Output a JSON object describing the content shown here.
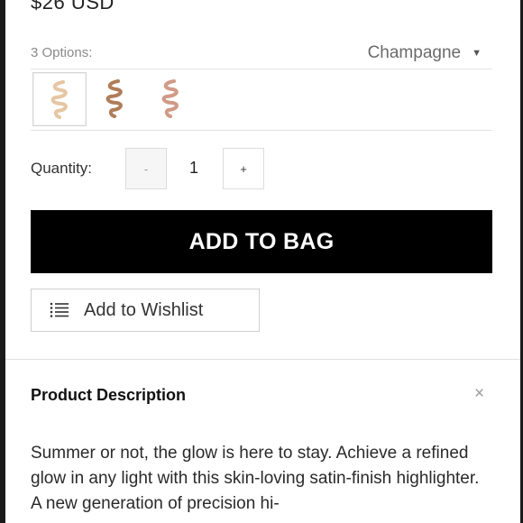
{
  "product": {
    "price": "$26 USD"
  },
  "options": {
    "label": "3 Options:",
    "selected_shade": "Champagne",
    "swatches": [
      {
        "name": "swatch-1",
        "color": "#e6c6a3",
        "selected": true
      },
      {
        "name": "swatch-2",
        "color": "#b07d5a",
        "selected": false
      },
      {
        "name": "swatch-3",
        "color": "#d19a86",
        "selected": false
      }
    ]
  },
  "quantity": {
    "label": "Quantity:",
    "minus": "-",
    "value": "1",
    "plus": "+"
  },
  "actions": {
    "add_to_bag": "ADD TO BAG",
    "wishlist": "Add to Wishlist"
  },
  "description": {
    "title": "Product Description",
    "close": "×",
    "text": "Summer or not, the glow is here to stay. Achieve a refined glow in any light with this skin-loving satin-finish highlighter. A new generation of precision hi-"
  },
  "colors": {
    "button_bg": "#000000",
    "button_text": "#ffffff",
    "muted_text": "#8a8a8a"
  }
}
